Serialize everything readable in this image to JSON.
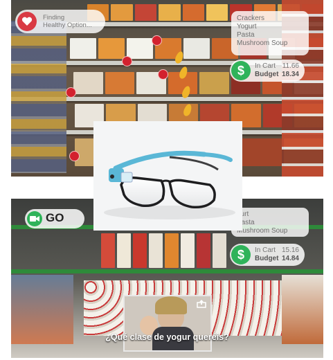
{
  "finding": {
    "line1": "Finding",
    "line2": "Healthy Option..."
  },
  "shopping_list_top": [
    "Crackers",
    "Yogurt",
    "Pasta",
    "Mushroom Soup"
  ],
  "shopping_list_bottom": [
    "gurt",
    "Pasta",
    "Mushroom Soup"
  ],
  "budget_top": {
    "in_cart_label": "In Cart",
    "in_cart_value": "11.66",
    "budget_label": "Budget",
    "budget_value": "18.34"
  },
  "budget_bottom": {
    "in_cart_label": "In Cart",
    "in_cart_value": "15.16",
    "budget_label": "Budget",
    "budget_value": "14.84"
  },
  "record": {
    "label": "GO"
  },
  "caption": "¿Qué clase de yogur queréis?",
  "colors": {
    "heart_red": "#d93a44",
    "pin_red": "#d3212e",
    "accent_green": "#2fb35a",
    "glasses_blue": "#5ab7d6"
  },
  "icons": [
    "heart-icon",
    "dollar-icon",
    "video-camera-icon",
    "share-icon"
  ]
}
